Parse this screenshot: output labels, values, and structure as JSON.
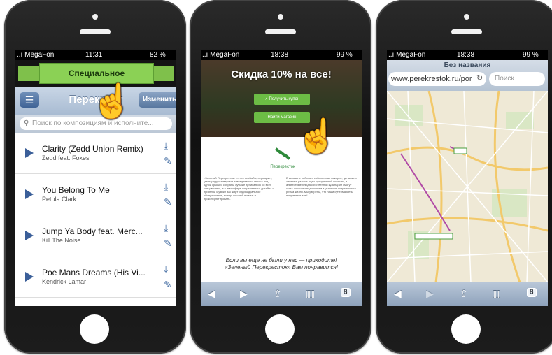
{
  "phone1": {
    "status": {
      "carrier": "..ı MegaFon",
      "time": "11:31",
      "battery": "82 %"
    },
    "banner": "Специальное предложение",
    "nav": {
      "title": "Перекрест",
      "edit": "Изменить"
    },
    "search_placeholder": "Поиск по композициям и исполните...",
    "tracks": [
      {
        "title": "Clarity (Zedd Union Remix)",
        "artist": "Zedd feat. Foxes"
      },
      {
        "title": "You Belong To Me",
        "artist": "Petula Clark"
      },
      {
        "title": "Jump Ya Body feat. Merc...",
        "artist": "Kill The Noise"
      },
      {
        "title": "Poe Mans Dreams (His Vi...",
        "artist": "Kendrick Lamar"
      }
    ]
  },
  "phone2": {
    "status": {
      "carrier": "..ı MegaFon",
      "time": "18:38",
      "battery": "99 %"
    },
    "headline": "Скидка 10% на все!",
    "btn_coupon": "✓ Получить купон",
    "btn_store": "Найти магазин",
    "logo_text": "Перекресток",
    "col_left": "«Зеленый Перекресток» — это особый супермаркет, где наряду с товарами повседневного спроса под одной крышей собраны лучшие деликатесы со всех концов света, а в атмосфере современного дизайна и приятной музыки вас ждет индивидуальное обслуживание, всегда готовый помочь и проконсультировать.",
    "col_right": "В магазине работает собственная пекарня, где можно заказать разные виды праздничной выпечки, а аппетитные блюда собственной кулинарии смогут стать хорошим подспорьем в условиях современного ритма жизни. Мы уверены, что наши супермаркеты понравятся вам!",
    "slogan_1": "Если вы еще не были у нас — приходите!",
    "slogan_2": "«Зеленый Перекресток» Вам понравится!",
    "tabs_count": "8"
  },
  "phone3": {
    "status": {
      "carrier": "..ı MegaFon",
      "time": "18:38",
      "battery": "99 %"
    },
    "title": "Без названия",
    "url": "www.perekrestok.ru/por",
    "search_placeholder": "Поиск",
    "tabs_count": "8"
  }
}
